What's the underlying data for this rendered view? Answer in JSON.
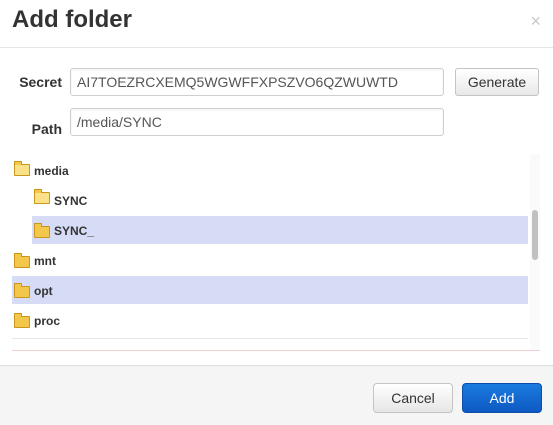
{
  "dialog": {
    "title": "Add folder",
    "close_icon": "×"
  },
  "form": {
    "secret_label": "Secret",
    "secret_value": "AI7TOEZRCXEMQ5WGWFFXPSZVO6QZWUWTD",
    "generate_label": "Generate",
    "path_label": "Path",
    "path_value": "/media/SYNC"
  },
  "tree": {
    "items": [
      {
        "label": "media",
        "icon": "folder-open-icon",
        "selected": false
      },
      {
        "label": "SYNC",
        "icon": "folder-open-icon",
        "selected": false
      },
      {
        "label": "SYNC_",
        "icon": "folder-icon",
        "selected": true
      },
      {
        "label": "mnt",
        "icon": "folder-icon",
        "selected": false
      },
      {
        "label": "opt",
        "icon": "folder-icon",
        "selected": true
      },
      {
        "label": "proc",
        "icon": "folder-icon",
        "selected": false
      }
    ]
  },
  "footer": {
    "cancel_label": "Cancel",
    "add_label": "Add"
  },
  "colors": {
    "selected_row": "#d6dcf6",
    "primary_button": "#0d59c2"
  }
}
